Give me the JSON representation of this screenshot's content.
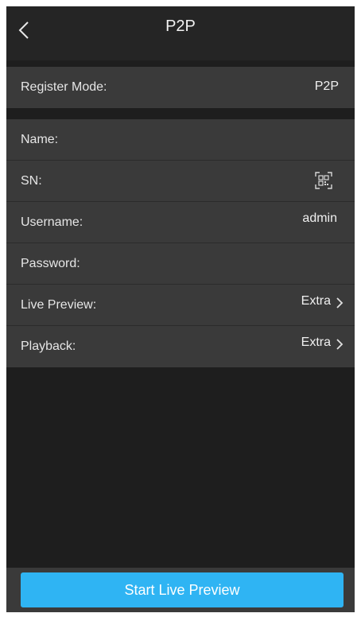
{
  "header": {
    "title": "P2P",
    "back_icon": "chevron-left-icon"
  },
  "register": {
    "label": "Register Mode:",
    "value": "P2P"
  },
  "fields": {
    "name_label": "Name:",
    "sn_label": "SN:",
    "sn_icon": "qr-code-scan-icon",
    "username_label": "Username:",
    "username_value": "admin",
    "password_label": "Password:",
    "live_preview_label": "Live Preview:",
    "live_preview_value": "Extra",
    "playback_label": "Playback:",
    "playback_value": "Extra",
    "chevron_icon": "chevron-right-icon"
  },
  "footer": {
    "start_button": "Start Live Preview"
  },
  "colors": {
    "background": "#1e1e1e",
    "row_background": "#3a3a3a",
    "accent": "#2fb4f3",
    "text": "#e6e6e6"
  }
}
